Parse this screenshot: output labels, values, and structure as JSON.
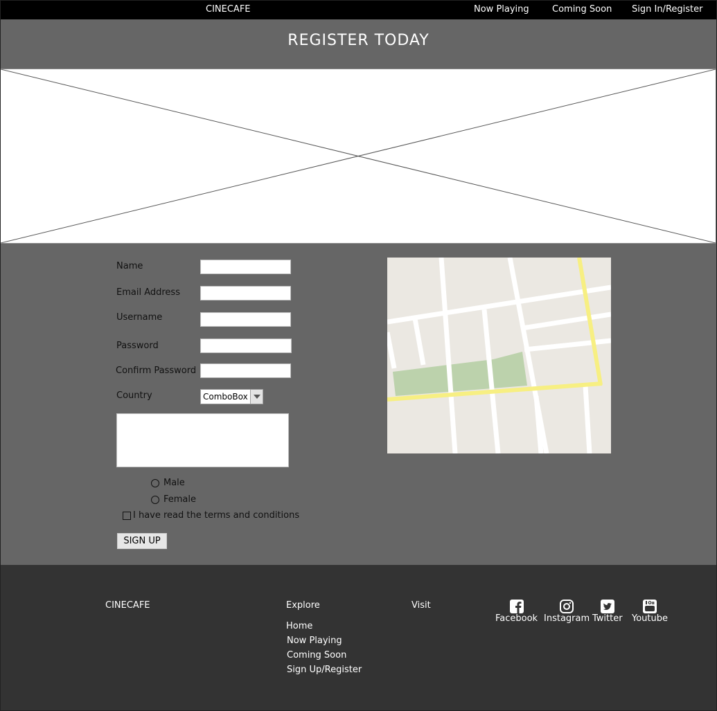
{
  "nav": {
    "brand": "CINECAFE",
    "links": [
      "Now Playing",
      "Coming Soon",
      "Sign In/Register"
    ]
  },
  "hero": {
    "title": "REGISTER TODAY"
  },
  "form": {
    "name_label": "Name",
    "email_label": "Email Address",
    "username_label": "Username",
    "password_label": "Password",
    "confirm_password_label": "Confirm Password",
    "country_label": "Country",
    "country_value": "ComboBox",
    "gender_options": [
      "Male",
      "Female"
    ],
    "terms_label": "I have read the terms and conditions",
    "signup_label": "SIGN UP"
  },
  "footer": {
    "brand": "CINECAFE",
    "explore_heading": "Explore",
    "explore_links": [
      "Home",
      "Now Playing",
      "Coming Soon",
      "Sign Up/Register"
    ],
    "visit_heading": "Visit",
    "social": [
      {
        "label": "Facebook",
        "icon": "facebook-icon"
      },
      {
        "label": "Instagram",
        "icon": "instagram-icon"
      },
      {
        "label": "Twitter",
        "icon": "twitter-icon"
      },
      {
        "label": "Youtube",
        "icon": "youtube-icon"
      }
    ]
  },
  "colors": {
    "page_bg": "#666666",
    "nav_bg": "#000000",
    "footer_bg": "#333333",
    "map_road_major": "#f7ef82",
    "map_park": "#bcd2ac"
  }
}
